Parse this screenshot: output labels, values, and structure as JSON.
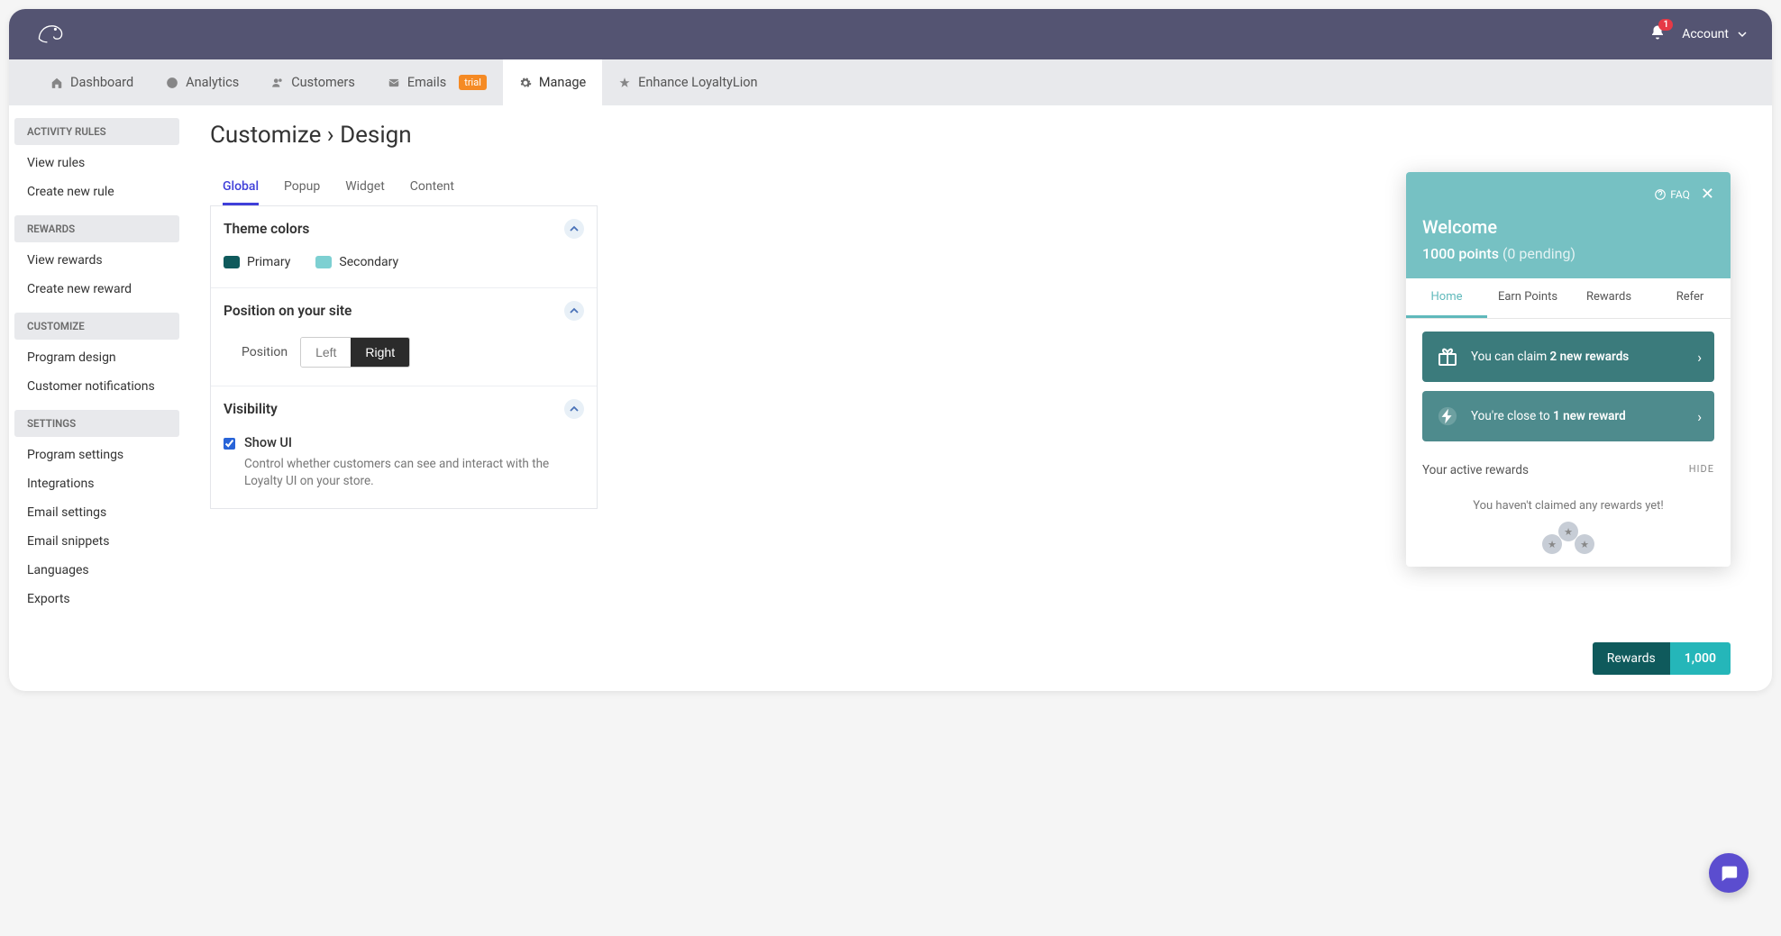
{
  "topbar": {
    "notification_count": "1",
    "account_label": "Account"
  },
  "nav": {
    "dashboard": "Dashboard",
    "analytics": "Analytics",
    "customers": "Customers",
    "emails": "Emails",
    "emails_badge": "trial",
    "manage": "Manage",
    "enhance": "Enhance LoyaltyLion"
  },
  "sidebar": {
    "groups": [
      {
        "header": "ACTIVITY RULES",
        "items": [
          "View rules",
          "Create new rule"
        ]
      },
      {
        "header": "REWARDS",
        "items": [
          "View rewards",
          "Create new reward"
        ]
      },
      {
        "header": "CUSTOMIZE",
        "items": [
          "Program design",
          "Customer notifications"
        ]
      },
      {
        "header": "SETTINGS",
        "items": [
          "Program settings",
          "Integrations",
          "Email settings",
          "Email snippets",
          "Languages",
          "Exports"
        ]
      }
    ]
  },
  "page": {
    "title": "Customize › Design"
  },
  "config_tabs": {
    "global": "Global",
    "popup": "Popup",
    "widget": "Widget",
    "content": "Content"
  },
  "theme": {
    "heading": "Theme colors",
    "primary_label": "Primary",
    "primary_color": "#0f5a5c",
    "secondary_label": "Secondary",
    "secondary_color": "#7dd0d2"
  },
  "position": {
    "heading": "Position on your site",
    "label": "Position",
    "left": "Left",
    "right": "Right",
    "selected": "Right"
  },
  "visibility": {
    "heading": "Visibility",
    "checkbox_label": "Show UI",
    "checked": true,
    "description": "Control whether customers can see and interact with the Loyalty UI on your store."
  },
  "preview": {
    "faq": "FAQ",
    "welcome": "Welcome",
    "points_value": "1000 points",
    "pending": "(0 pending)",
    "tabs": {
      "home": "Home",
      "earn": "Earn Points",
      "rewards": "Rewards",
      "refer": "Refer"
    },
    "cta1_prefix": "You can claim ",
    "cta1_bold": "2 new rewards",
    "cta2_prefix": "You're close to ",
    "cta2_bold": "1 new reward",
    "active_rewards_heading": "Your active rewards",
    "hide": "HIDE",
    "empty": "You haven't claimed any rewards yet!",
    "pill_label": "Rewards",
    "pill_value": "1,000"
  }
}
